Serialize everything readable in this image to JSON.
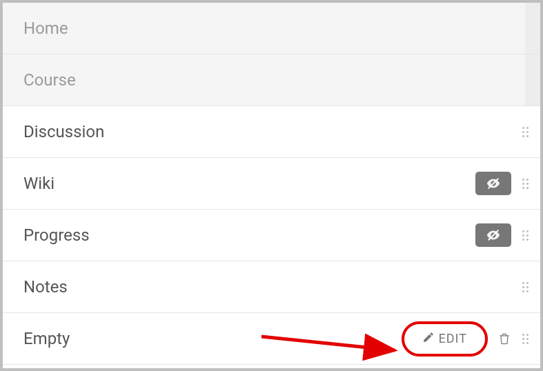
{
  "items": [
    {
      "label": "Home",
      "muted": true,
      "hidden": false,
      "draggable": false,
      "editable": false
    },
    {
      "label": "Course",
      "muted": true,
      "hidden": false,
      "draggable": false,
      "editable": false
    },
    {
      "label": "Discussion",
      "muted": false,
      "hidden": false,
      "draggable": true,
      "editable": false
    },
    {
      "label": "Wiki",
      "muted": false,
      "hidden": true,
      "draggable": true,
      "editable": false
    },
    {
      "label": "Progress",
      "muted": false,
      "hidden": true,
      "draggable": true,
      "editable": false
    },
    {
      "label": "Notes",
      "muted": false,
      "hidden": false,
      "draggable": true,
      "editable": false
    },
    {
      "label": "Empty",
      "muted": false,
      "hidden": false,
      "draggable": true,
      "editable": true,
      "highlighted": true
    }
  ],
  "editLabel": "EDIT"
}
